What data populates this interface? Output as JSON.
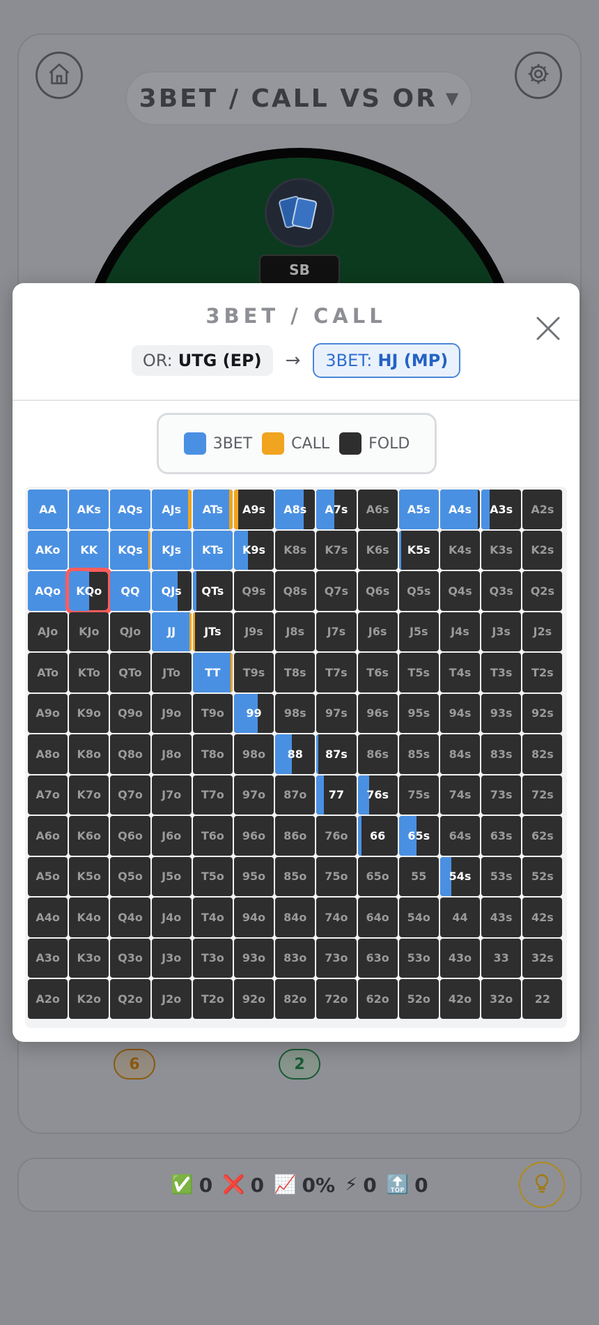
{
  "header": {
    "mode_title": "3BET / CALL VS OR"
  },
  "table": {
    "seat_label": "SB"
  },
  "badges": [
    {
      "label": "6",
      "color": "#c07a10"
    },
    {
      "label": "2",
      "color": "#1e6b3e"
    }
  ],
  "stats": {
    "correct": "0",
    "wrong": "0",
    "accuracy": "0%",
    "streak": "0",
    "best": "0"
  },
  "modal": {
    "title": "3BET / CALL",
    "or_prefix": "OR:",
    "or_position": "UTG (EP)",
    "arrow": "→",
    "threebet_prefix": "3BET:",
    "threebet_position": "HJ (MP)"
  },
  "legend": [
    {
      "label": "3BET",
      "color": "#4a90e2"
    },
    {
      "label": "CALL",
      "color": "#f0a41f"
    },
    {
      "label": "FOLD",
      "color": "#2e2e2e"
    }
  ],
  "hand_grid": [
    [
      {
        "h": "AA",
        "b": 100,
        "c": 0
      },
      {
        "h": "AKs",
        "b": 100,
        "c": 0
      },
      {
        "h": "AQs",
        "b": 100,
        "c": 0
      },
      {
        "h": "AJs",
        "b": 92,
        "c": 8
      },
      {
        "h": "ATs",
        "b": 92,
        "c": 8
      },
      {
        "h": "A9s",
        "b": 0,
        "c": 10
      },
      {
        "h": "A8s",
        "b": 72,
        "c": 0
      },
      {
        "h": "A7s",
        "b": 45,
        "c": 0
      },
      {
        "h": "A6s",
        "b": 0,
        "c": 0
      },
      {
        "h": "A5s",
        "b": 100,
        "c": 0
      },
      {
        "h": "A4s",
        "b": 95,
        "c": 0
      },
      {
        "h": "A3s",
        "b": 20,
        "c": 0
      },
      {
        "h": "A2s",
        "b": 0,
        "c": 0
      }
    ],
    [
      {
        "h": "AKo",
        "b": 100,
        "c": 0
      },
      {
        "h": "KK",
        "b": 100,
        "c": 0
      },
      {
        "h": "KQs",
        "b": 95,
        "c": 5
      },
      {
        "h": "KJs",
        "b": 100,
        "c": 0
      },
      {
        "h": "KTs",
        "b": 100,
        "c": 0
      },
      {
        "h": "K9s",
        "b": 35,
        "c": 0
      },
      {
        "h": "K8s",
        "b": 0,
        "c": 0
      },
      {
        "h": "K7s",
        "b": 0,
        "c": 0
      },
      {
        "h": "K6s",
        "b": 0,
        "c": 0
      },
      {
        "h": "K5s",
        "b": 5,
        "c": 0
      },
      {
        "h": "K4s",
        "b": 0,
        "c": 0
      },
      {
        "h": "K3s",
        "b": 0,
        "c": 0
      },
      {
        "h": "K2s",
        "b": 0,
        "c": 0
      }
    ],
    [
      {
        "h": "AQo",
        "b": 100,
        "c": 0
      },
      {
        "h": "KQo",
        "b": 50,
        "c": 0
      },
      {
        "h": "QQ",
        "b": 100,
        "c": 0
      },
      {
        "h": "QJs",
        "b": 65,
        "c": 0
      },
      {
        "h": "QTs",
        "b": 10,
        "c": 0
      },
      {
        "h": "Q9s",
        "b": 0,
        "c": 0
      },
      {
        "h": "Q8s",
        "b": 0,
        "c": 0
      },
      {
        "h": "Q7s",
        "b": 0,
        "c": 0
      },
      {
        "h": "Q6s",
        "b": 0,
        "c": 0
      },
      {
        "h": "Q5s",
        "b": 0,
        "c": 0
      },
      {
        "h": "Q4s",
        "b": 0,
        "c": 0
      },
      {
        "h": "Q3s",
        "b": 0,
        "c": 0
      },
      {
        "h": "Q2s",
        "b": 0,
        "c": 0
      }
    ],
    [
      {
        "h": "AJo",
        "b": 0,
        "c": 0
      },
      {
        "h": "KJo",
        "b": 0,
        "c": 0
      },
      {
        "h": "QJo",
        "b": 0,
        "c": 0
      },
      {
        "h": "JJ",
        "b": 95,
        "c": 5
      },
      {
        "h": "JTs",
        "b": 0,
        "c": 5
      },
      {
        "h": "J9s",
        "b": 0,
        "c": 0
      },
      {
        "h": "J8s",
        "b": 0,
        "c": 0
      },
      {
        "h": "J7s",
        "b": 0,
        "c": 0
      },
      {
        "h": "J6s",
        "b": 0,
        "c": 0
      },
      {
        "h": "J5s",
        "b": 0,
        "c": 0
      },
      {
        "h": "J4s",
        "b": 0,
        "c": 0
      },
      {
        "h": "J3s",
        "b": 0,
        "c": 0
      },
      {
        "h": "J2s",
        "b": 0,
        "c": 0
      }
    ],
    [
      {
        "h": "ATo",
        "b": 0,
        "c": 0
      },
      {
        "h": "KTo",
        "b": 0,
        "c": 0
      },
      {
        "h": "QTo",
        "b": 0,
        "c": 0
      },
      {
        "h": "JTo",
        "b": 0,
        "c": 0
      },
      {
        "h": "TT",
        "b": 95,
        "c": 5
      },
      {
        "h": "T9s",
        "b": 0,
        "c": 0
      },
      {
        "h": "T8s",
        "b": 0,
        "c": 0
      },
      {
        "h": "T7s",
        "b": 0,
        "c": 0
      },
      {
        "h": "T6s",
        "b": 0,
        "c": 0
      },
      {
        "h": "T5s",
        "b": 0,
        "c": 0
      },
      {
        "h": "T4s",
        "b": 0,
        "c": 0
      },
      {
        "h": "T3s",
        "b": 0,
        "c": 0
      },
      {
        "h": "T2s",
        "b": 0,
        "c": 0
      }
    ],
    [
      {
        "h": "A9o",
        "b": 0,
        "c": 0
      },
      {
        "h": "K9o",
        "b": 0,
        "c": 0
      },
      {
        "h": "Q9o",
        "b": 0,
        "c": 0
      },
      {
        "h": "J9o",
        "b": 0,
        "c": 0
      },
      {
        "h": "T9o",
        "b": 0,
        "c": 0
      },
      {
        "h": "99",
        "b": 60,
        "c": 0
      },
      {
        "h": "98s",
        "b": 0,
        "c": 0
      },
      {
        "h": "97s",
        "b": 0,
        "c": 0
      },
      {
        "h": "96s",
        "b": 0,
        "c": 0
      },
      {
        "h": "95s",
        "b": 0,
        "c": 0
      },
      {
        "h": "94s",
        "b": 0,
        "c": 0
      },
      {
        "h": "93s",
        "b": 0,
        "c": 0
      },
      {
        "h": "92s",
        "b": 0,
        "c": 0
      }
    ],
    [
      {
        "h": "A8o",
        "b": 0,
        "c": 0
      },
      {
        "h": "K8o",
        "b": 0,
        "c": 0
      },
      {
        "h": "Q8o",
        "b": 0,
        "c": 0
      },
      {
        "h": "J8o",
        "b": 0,
        "c": 0
      },
      {
        "h": "T8o",
        "b": 0,
        "c": 0
      },
      {
        "h": "98o",
        "b": 0,
        "c": 0
      },
      {
        "h": "88",
        "b": 42,
        "c": 0
      },
      {
        "h": "87s",
        "b": 5,
        "c": 0
      },
      {
        "h": "86s",
        "b": 0,
        "c": 0
      },
      {
        "h": "85s",
        "b": 0,
        "c": 0
      },
      {
        "h": "84s",
        "b": 0,
        "c": 0
      },
      {
        "h": "83s",
        "b": 0,
        "c": 0
      },
      {
        "h": "82s",
        "b": 0,
        "c": 0
      }
    ],
    [
      {
        "h": "A7o",
        "b": 0,
        "c": 0
      },
      {
        "h": "K7o",
        "b": 0,
        "c": 0
      },
      {
        "h": "Q7o",
        "b": 0,
        "c": 0
      },
      {
        "h": "J7o",
        "b": 0,
        "c": 0
      },
      {
        "h": "T7o",
        "b": 0,
        "c": 0
      },
      {
        "h": "97o",
        "b": 0,
        "c": 0
      },
      {
        "h": "87o",
        "b": 0,
        "c": 0
      },
      {
        "h": "77",
        "b": 18,
        "c": 0
      },
      {
        "h": "76s",
        "b": 28,
        "c": 0
      },
      {
        "h": "75s",
        "b": 0,
        "c": 0
      },
      {
        "h": "74s",
        "b": 0,
        "c": 0
      },
      {
        "h": "73s",
        "b": 0,
        "c": 0
      },
      {
        "h": "72s",
        "b": 0,
        "c": 0
      }
    ],
    [
      {
        "h": "A6o",
        "b": 0,
        "c": 0
      },
      {
        "h": "K6o",
        "b": 0,
        "c": 0
      },
      {
        "h": "Q6o",
        "b": 0,
        "c": 0
      },
      {
        "h": "J6o",
        "b": 0,
        "c": 0
      },
      {
        "h": "T6o",
        "b": 0,
        "c": 0
      },
      {
        "h": "96o",
        "b": 0,
        "c": 0
      },
      {
        "h": "86o",
        "b": 0,
        "c": 0
      },
      {
        "h": "76o",
        "b": 0,
        "c": 0
      },
      {
        "h": "66",
        "b": 10,
        "c": 0
      },
      {
        "h": "65s",
        "b": 45,
        "c": 0
      },
      {
        "h": "64s",
        "b": 0,
        "c": 0
      },
      {
        "h": "63s",
        "b": 0,
        "c": 0
      },
      {
        "h": "62s",
        "b": 0,
        "c": 0
      }
    ],
    [
      {
        "h": "A5o",
        "b": 0,
        "c": 0
      },
      {
        "h": "K5o",
        "b": 0,
        "c": 0
      },
      {
        "h": "Q5o",
        "b": 0,
        "c": 0
      },
      {
        "h": "J5o",
        "b": 0,
        "c": 0
      },
      {
        "h": "T5o",
        "b": 0,
        "c": 0
      },
      {
        "h": "95o",
        "b": 0,
        "c": 0
      },
      {
        "h": "85o",
        "b": 0,
        "c": 0
      },
      {
        "h": "75o",
        "b": 0,
        "c": 0
      },
      {
        "h": "65o",
        "b": 0,
        "c": 0
      },
      {
        "h": "55",
        "b": 0,
        "c": 0
      },
      {
        "h": "54s",
        "b": 28,
        "c": 0
      },
      {
        "h": "53s",
        "b": 0,
        "c": 0
      },
      {
        "h": "52s",
        "b": 0,
        "c": 0
      }
    ],
    [
      {
        "h": "A4o",
        "b": 0,
        "c": 0
      },
      {
        "h": "K4o",
        "b": 0,
        "c": 0
      },
      {
        "h": "Q4o",
        "b": 0,
        "c": 0
      },
      {
        "h": "J4o",
        "b": 0,
        "c": 0
      },
      {
        "h": "T4o",
        "b": 0,
        "c": 0
      },
      {
        "h": "94o",
        "b": 0,
        "c": 0
      },
      {
        "h": "84o",
        "b": 0,
        "c": 0
      },
      {
        "h": "74o",
        "b": 0,
        "c": 0
      },
      {
        "h": "64o",
        "b": 0,
        "c": 0
      },
      {
        "h": "54o",
        "b": 0,
        "c": 0
      },
      {
        "h": "44",
        "b": 0,
        "c": 0
      },
      {
        "h": "43s",
        "b": 0,
        "c": 0
      },
      {
        "h": "42s",
        "b": 0,
        "c": 0
      }
    ],
    [
      {
        "h": "A3o",
        "b": 0,
        "c": 0
      },
      {
        "h": "K3o",
        "b": 0,
        "c": 0
      },
      {
        "h": "Q3o",
        "b": 0,
        "c": 0
      },
      {
        "h": "J3o",
        "b": 0,
        "c": 0
      },
      {
        "h": "T3o",
        "b": 0,
        "c": 0
      },
      {
        "h": "93o",
        "b": 0,
        "c": 0
      },
      {
        "h": "83o",
        "b": 0,
        "c": 0
      },
      {
        "h": "73o",
        "b": 0,
        "c": 0
      },
      {
        "h": "63o",
        "b": 0,
        "c": 0
      },
      {
        "h": "53o",
        "b": 0,
        "c": 0
      },
      {
        "h": "43o",
        "b": 0,
        "c": 0
      },
      {
        "h": "33",
        "b": 0,
        "c": 0
      },
      {
        "h": "32s",
        "b": 0,
        "c": 0
      }
    ],
    [
      {
        "h": "A2o",
        "b": 0,
        "c": 0
      },
      {
        "h": "K2o",
        "b": 0,
        "c": 0
      },
      {
        "h": "Q2o",
        "b": 0,
        "c": 0
      },
      {
        "h": "J2o",
        "b": 0,
        "c": 0
      },
      {
        "h": "T2o",
        "b": 0,
        "c": 0
      },
      {
        "h": "92o",
        "b": 0,
        "c": 0
      },
      {
        "h": "82o",
        "b": 0,
        "c": 0
      },
      {
        "h": "72o",
        "b": 0,
        "c": 0
      },
      {
        "h": "62o",
        "b": 0,
        "c": 0
      },
      {
        "h": "52o",
        "b": 0,
        "c": 0
      },
      {
        "h": "42o",
        "b": 0,
        "c": 0
      },
      {
        "h": "32o",
        "b": 0,
        "c": 0
      },
      {
        "h": "22",
        "b": 0,
        "c": 0
      }
    ]
  ],
  "selected_hand": "KQo"
}
